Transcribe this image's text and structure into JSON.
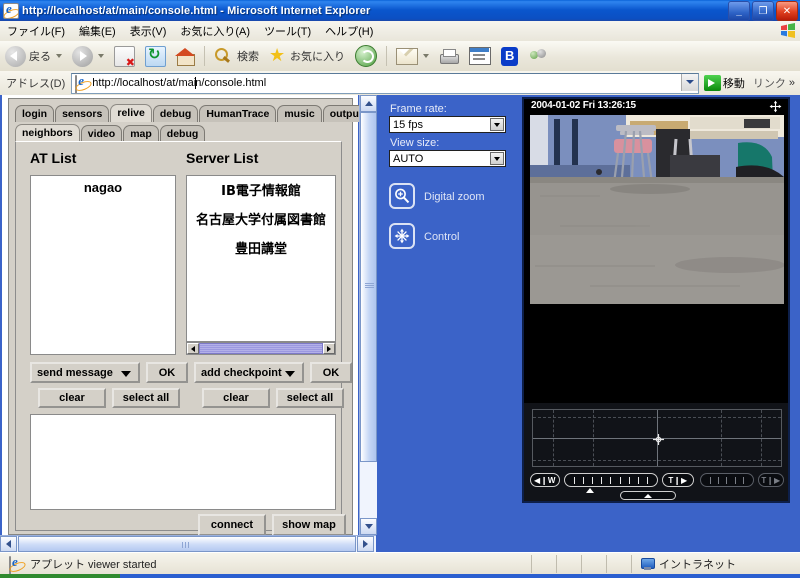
{
  "window": {
    "title": "http://localhost/at/main/console.html - Microsoft Internet Explorer",
    "minimize": "_",
    "restore": "❐",
    "close": "✕"
  },
  "menu": {
    "items": [
      "ファイル(F)",
      "編集(E)",
      "表示(V)",
      "お気に入り(A)",
      "ツール(T)",
      "ヘルプ(H)"
    ]
  },
  "toolbar": {
    "back": "戻る",
    "forward": "",
    "stop": "",
    "refresh": "",
    "home": "",
    "search": "検索",
    "favorites": "お気に入り",
    "history": "",
    "mail": "",
    "print": "",
    "edit": "",
    "bluetooth": "",
    "messenger": ""
  },
  "address": {
    "label": "アドレス(D)",
    "url_before_caret": "http://localhost/at/mai",
    "url_after_caret": "n/console.html",
    "go_label": "移動",
    "links_label": "リンク",
    "chevron": "»"
  },
  "applet": {
    "tabs_main": [
      {
        "label": "login",
        "selected": false
      },
      {
        "label": "sensors",
        "selected": false
      },
      {
        "label": "relive",
        "selected": true
      },
      {
        "label": "debug",
        "selected": false
      },
      {
        "label": "HumanTrace",
        "selected": false
      },
      {
        "label": "music",
        "selected": false
      },
      {
        "label": "output",
        "selected": false
      }
    ],
    "tabs_sub": [
      {
        "label": "neighbors",
        "selected": true
      },
      {
        "label": "video",
        "selected": false
      },
      {
        "label": "map",
        "selected": false
      },
      {
        "label": "debug",
        "selected": false
      }
    ],
    "at_list": {
      "header": "AT List",
      "items": [
        "nagao"
      ]
    },
    "server_list": {
      "header": "Server List",
      "items": [
        "IB電子情報館",
        "名古屋大学付属図書館",
        "豊田講堂"
      ]
    },
    "left_controls": {
      "combo_value": "send message",
      "ok_label": "OK",
      "clear_label": "clear",
      "select_all_label": "select all"
    },
    "right_controls": {
      "combo_value": "add checkpoint",
      "ok_label": "OK",
      "clear_label": "clear",
      "select_all_label": "select all"
    },
    "message_area": "",
    "bottom_buttons": {
      "connect": "connect",
      "show_map": "show map"
    }
  },
  "camera": {
    "frame_rate_label": "Frame rate:",
    "frame_rate_value": "15 fps",
    "view_size_label": "View size:",
    "view_size_value": "AUTO",
    "digital_zoom_label": "Digital zoom",
    "control_label": "Control",
    "timestamp": "2004-01-02 Fri 13:26:15",
    "zoom_wide_label": "◀❙W",
    "zoom_tele_label": "T❙▶",
    "focus_tele_label": "T❙▶",
    "move_icon": "✥",
    "crosshair_icon": "✥"
  },
  "statusbar": {
    "message": "アプレット viewer started",
    "zone": "イントラネット"
  }
}
